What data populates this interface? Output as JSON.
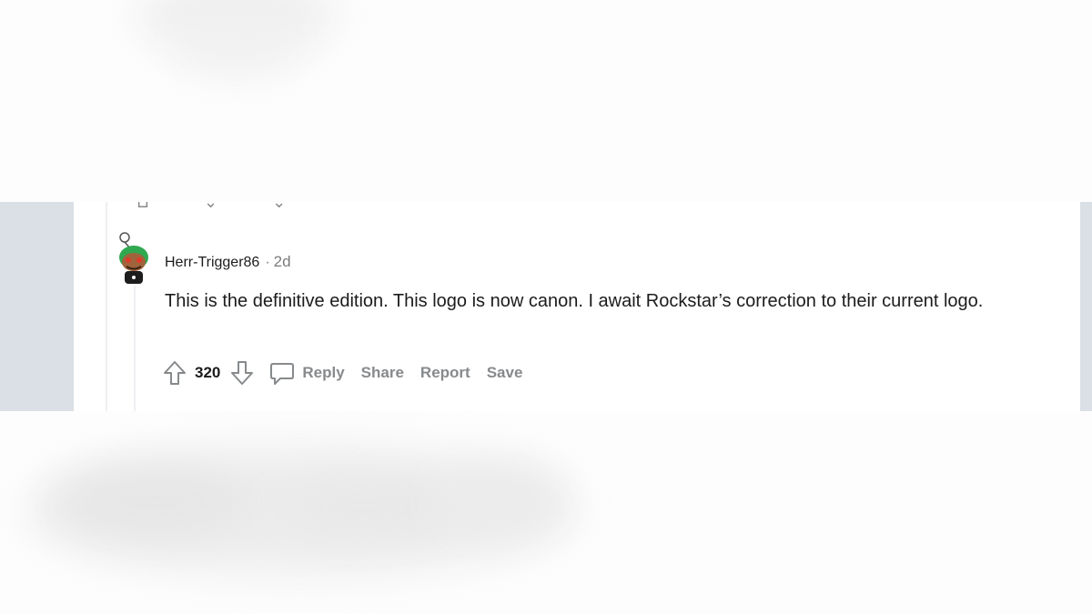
{
  "comment": {
    "author": "Herr-Trigger86",
    "separator": "·",
    "time": "2d",
    "text": "This is the definitive edition. This logo is now canon. I await Rockstar’s correction to their current logo.",
    "score": "320",
    "actions": {
      "reply": "Reply",
      "share": "Share",
      "report": "Report",
      "save": "Save"
    }
  },
  "icons": {
    "upvote": "arrow-up-outline-icon",
    "downvote": "arrow-down-outline-icon",
    "reply": "speech-bubble-icon",
    "avatar": "snoo-avatar"
  },
  "colors": {
    "sidebar_gray": "#dae0e6",
    "muted_text": "#878a8c",
    "body_text": "#1c1c1c"
  }
}
